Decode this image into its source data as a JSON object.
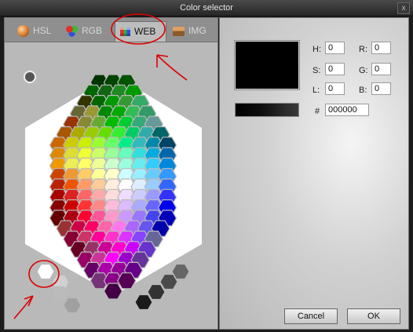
{
  "window": {
    "title": "Color selector",
    "close_glyph": "x"
  },
  "tabs": [
    {
      "label": "HSL",
      "icon": "hsl-sphere-icon",
      "active": false
    },
    {
      "label": "RGB",
      "icon": "rgb-circles-icon",
      "active": false
    },
    {
      "label": "WEB",
      "icon": "web-grid-icon",
      "active": true
    },
    {
      "label": "IMG",
      "icon": "image-icon",
      "active": false
    }
  ],
  "fields": {
    "h": {
      "label": "H:",
      "value": "0"
    },
    "s": {
      "label": "S:",
      "value": "0"
    },
    "l": {
      "label": "L:",
      "value": "0"
    },
    "r": {
      "label": "R:",
      "value": "0"
    },
    "g": {
      "label": "G:",
      "value": "0"
    },
    "b": {
      "label": "B:",
      "value": "0"
    },
    "hex": {
      "label": "#",
      "value": "000000"
    }
  },
  "preview": {
    "color": "#000000"
  },
  "buttons": {
    "cancel": "Cancel",
    "ok": "OK"
  },
  "swatches": {
    "hexagon_rows": [
      [
        "#003300",
        "#004400",
        "#005500"
      ],
      [
        "#006600",
        "#116611",
        "#228822",
        "#009900"
      ],
      [
        "#333300",
        "#006600",
        "#009900",
        "#339933",
        "#33aa66"
      ],
      [
        "#666633",
        "#999933",
        "#008800",
        "#00aa00",
        "#33bb55",
        "#339966"
      ],
      [
        "#993300",
        "#888833",
        "#66aa33",
        "#00bb00",
        "#00cc33",
        "#33aa77",
        "#669999"
      ],
      [
        "#aa5500",
        "#aaaa00",
        "#99cc00",
        "#66dd00",
        "#33ee33",
        "#00cc66",
        "#33aaaa",
        "#006666"
      ],
      [
        "#cc6600",
        "#cccc00",
        "#ccee00",
        "#99ff33",
        "#66ff66",
        "#00ee88",
        "#33bbbb",
        "#0088aa",
        "#004466"
      ],
      [
        "#dd8800",
        "#dddd33",
        "#eeff33",
        "#ccff66",
        "#99ff99",
        "#66ffbb",
        "#33dddd",
        "#00aadd",
        "#0066aa"
      ],
      [
        "#ee9900",
        "#eeee55",
        "#ffff66",
        "#eeff99",
        "#ccffcc",
        "#99ffdd",
        "#66eeee",
        "#33ccff",
        "#0088dd"
      ],
      [
        "#cc4400",
        "#ee9933",
        "#ffcc66",
        "#ffff99",
        "#ffffcc",
        "#ccffff",
        "#99eeff",
        "#66ccff",
        "#3399ff"
      ],
      [
        "#bb2200",
        "#ee5500",
        "#ff9966",
        "#ffcc99",
        "#ffeedd",
        "#ffffff",
        "#ddeeff",
        "#99ccff",
        "#3366ff"
      ],
      [
        "#aa0000",
        "#dd2222",
        "#ff6666",
        "#ffaaaa",
        "#ffdddd",
        "#eeddff",
        "#ccccff",
        "#9999ff",
        "#3333ff"
      ],
      [
        "#880000",
        "#cc0000",
        "#ff3333",
        "#ff8888",
        "#ffbbdd",
        "#ddbbff",
        "#aaaaff",
        "#6666ff",
        "#0000ee"
      ],
      [
        "#660000",
        "#aa0011",
        "#ff0033",
        "#ff5599",
        "#ff99cc",
        "#cc99ff",
        "#9977ff",
        "#4444ee",
        "#0000bb"
      ],
      [
        "#993333",
        "#cc0044",
        "#ff0066",
        "#ff66aa",
        "#ff77ee",
        "#aa66ff",
        "#6655ee",
        "#0000aa"
      ],
      [
        "#880033",
        "#cc3366",
        "#ff0099",
        "#ff33cc",
        "#dd33ff",
        "#8844ff",
        "#666699"
      ],
      [
        "#660022",
        "#993366",
        "#cc0099",
        "#ff00cc",
        "#cc00ff",
        "#6633cc"
      ],
      [
        "#990066",
        "#cc3399",
        "#ff00ff",
        "#9900cc",
        "#663399"
      ],
      [
        "#660066",
        "#aa00aa",
        "#990099",
        "#660088"
      ],
      [
        "#773377",
        "#880088",
        "#550055"
      ],
      [
        "#440044"
      ]
    ],
    "gray_left": [
      "#ffffff",
      "#d0d0d0",
      "#bbbbbb",
      "#a0a0a0"
    ],
    "gray_right": [
      "#666666",
      "#4a4a4a",
      "#333333",
      "#1a1a1a",
      "#000000"
    ]
  },
  "annotation_color": "#dd0000"
}
